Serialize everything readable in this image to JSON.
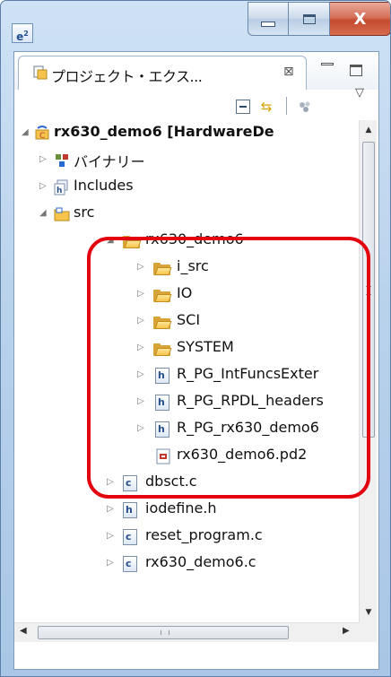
{
  "window": {
    "app_icon": "e",
    "app_icon_sup": "2",
    "close_glyph": "X"
  },
  "view": {
    "tab_title": "プロジェクト・エクス...",
    "tab_close_glyph": "⊠",
    "menu_glyph": "▽",
    "toolbar_link_glyph": "⇆"
  },
  "tree": {
    "project": {
      "label": "rx630_demo6 [HardwareDe",
      "expanded": true
    },
    "items": [
      {
        "label": "バイナリー",
        "icon": "binaries-icon",
        "twisty": "▷"
      },
      {
        "label": "Includes",
        "icon": "includes-icon",
        "twisty": "▷"
      },
      {
        "label": "src",
        "icon": "source-folder-icon",
        "twisty": "◢"
      },
      {
        "label": "rx630_demo6",
        "icon": "folder-open-icon",
        "twisty": "◢"
      },
      {
        "label": "i_src",
        "icon": "folder-icon",
        "twisty": "▷"
      },
      {
        "label": "IO",
        "icon": "folder-icon",
        "twisty": "▷"
      },
      {
        "label": "SCI",
        "icon": "folder-icon",
        "twisty": "▷"
      },
      {
        "label": "SYSTEM",
        "icon": "folder-icon",
        "twisty": "▷"
      },
      {
        "label": "R_PG_IntFuncsExter",
        "icon": "header-file-icon",
        "twisty": "▷"
      },
      {
        "label": "R_PG_RPDL_headers",
        "icon": "header-file-icon",
        "twisty": "▷"
      },
      {
        "label": "R_PG_rx630_demo6",
        "icon": "header-file-icon",
        "twisty": "▷"
      },
      {
        "label": "rx630_demo6.pd2",
        "icon": "pd2-file-icon",
        "twisty": ""
      },
      {
        "label": "dbsct.c",
        "icon": "c-file-icon",
        "twisty": "▷"
      },
      {
        "label": "iodefine.h",
        "icon": "header-file-icon",
        "twisty": "▷"
      },
      {
        "label": "reset_program.c",
        "icon": "c-file-icon",
        "twisty": "▷"
      },
      {
        "label": "rx630_demo6.c",
        "icon": "c-file-icon",
        "twisty": "▷"
      }
    ]
  },
  "scrollbars": {
    "up": "▲",
    "down": "▼",
    "left": "◀",
    "right": "▶"
  },
  "colors": {
    "highlight": "#e3000f",
    "folder": "#f6c44c",
    "title_gradient": "#b9d2ec"
  }
}
